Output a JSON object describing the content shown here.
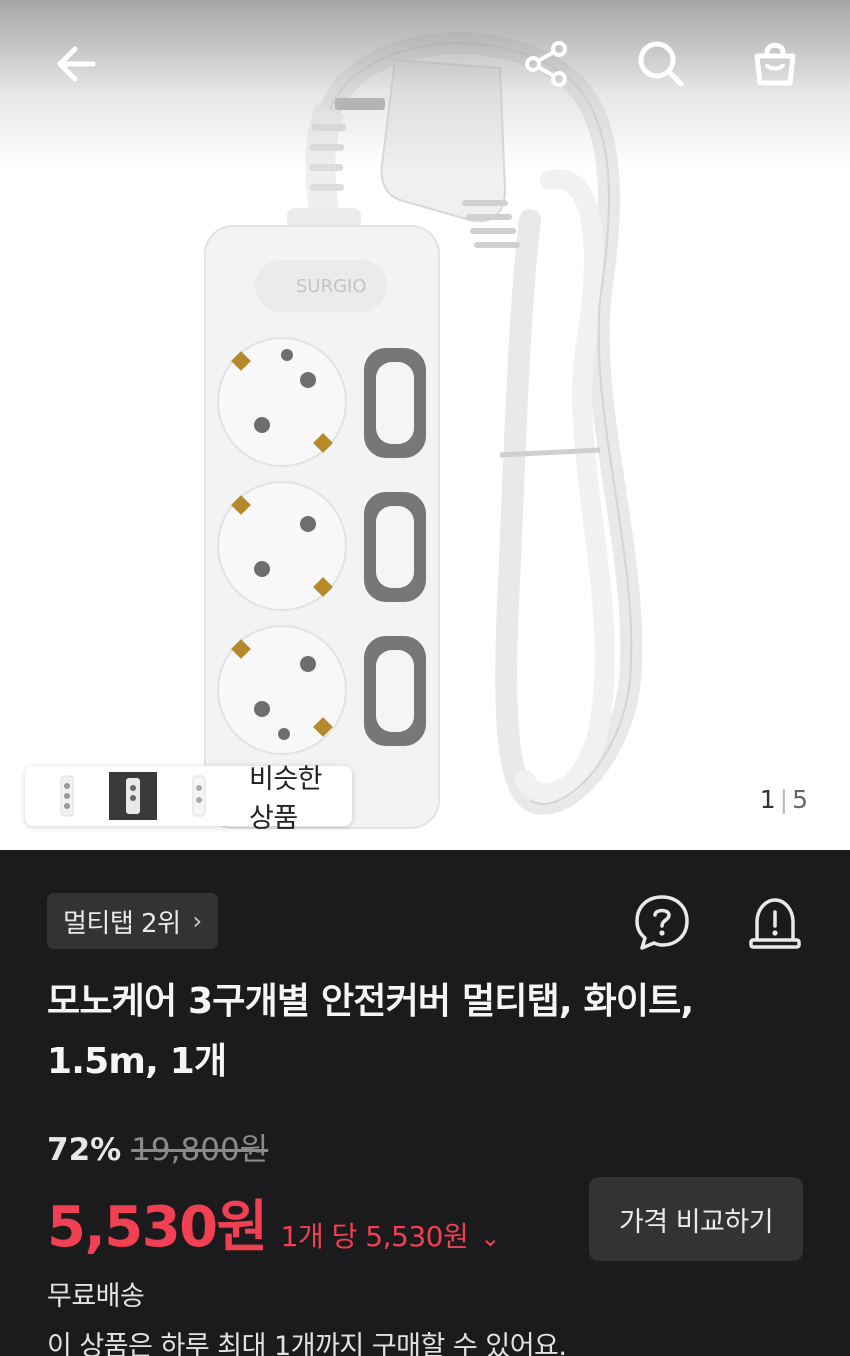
{
  "header": {
    "back_icon": "arrow-left-icon",
    "share_icon": "share-icon",
    "search_icon": "search-icon",
    "cart_icon": "shopping-bag-icon"
  },
  "gallery": {
    "similar_products_label": "비슷한 상품",
    "current_page": "1",
    "page_separator": "|",
    "total_pages": "5"
  },
  "product": {
    "rank_badge": "멀티탭 2위",
    "rank_chevron": "›",
    "title_line1": "모노케어 3구개별 안전커버 멀티탭, 화이트,",
    "title_line2": "1.5m, 1개",
    "discount_rate": "72%",
    "original_price": "19,800원",
    "sale_price": "5,530원",
    "unit_price": "1개 당 5,530원",
    "unit_price_chevron": "⌄",
    "compare_button": "가격 비교하기",
    "shipping": "무료배송",
    "purchase_limit": "이 상품은 하루 최대 1개까지 구매할 수 있어요."
  },
  "colors": {
    "accent_price": "#f04052",
    "background_dark": "#1b1b1d",
    "chip_dark": "#333336"
  }
}
